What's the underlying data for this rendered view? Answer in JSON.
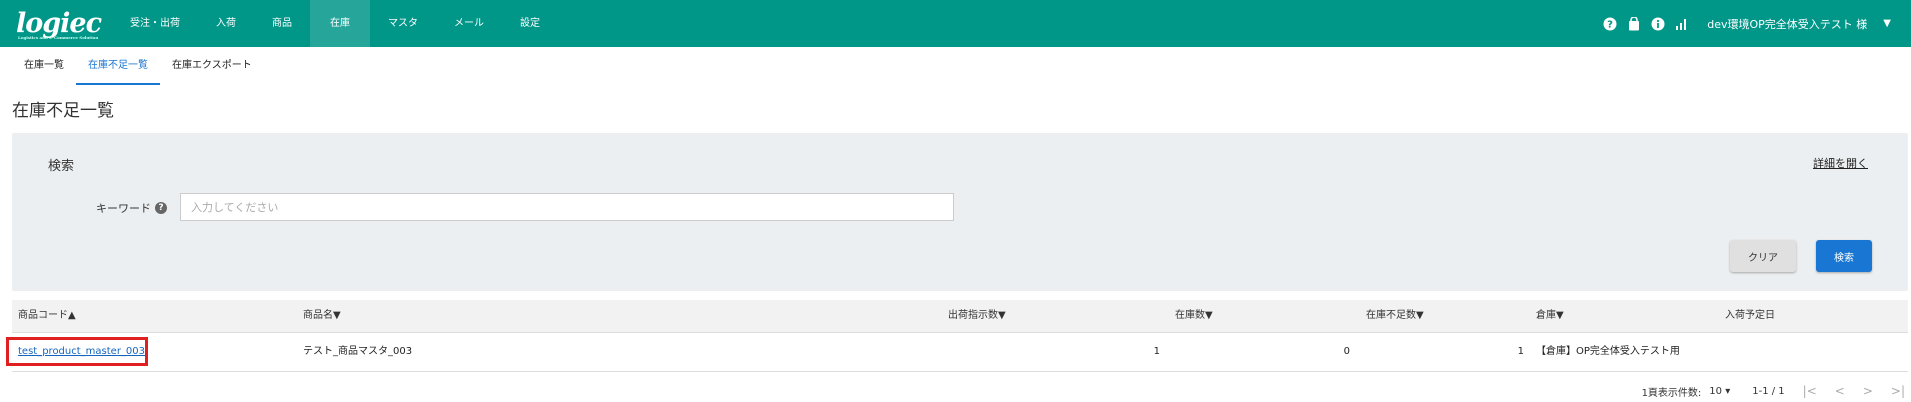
{
  "header": {
    "logo": "logiec",
    "logo_sub": "Logistics and E-Commerce Solution",
    "nav": [
      "受注・出荷",
      "入荷",
      "商品",
      "在庫",
      "マスタ",
      "メール",
      "設定"
    ],
    "active_nav": "在庫",
    "user": "dev環境OP完全体受入テスト 様",
    "icons": [
      "help-icon",
      "bag-icon",
      "info-icon",
      "signal-icon"
    ]
  },
  "subnav": {
    "tabs": [
      "在庫一覧",
      "在庫不足一覧",
      "在庫エクスポート"
    ],
    "active": "在庫不足一覧"
  },
  "page": {
    "title": "在庫不足一覧"
  },
  "search": {
    "title": "検索",
    "detail_link": "詳細を開く",
    "keyword_label": "キーワード",
    "keyword_help": "?",
    "keyword_placeholder": "入力してください",
    "keyword_value": "",
    "clear_label": "クリア",
    "search_label": "検索"
  },
  "table": {
    "columns": [
      "商品コード▲",
      "商品名▼",
      "出荷指示数▼",
      "在庫数▼",
      "在庫不足数▼",
      "倉庫▼",
      "入荷予定日"
    ],
    "rows": [
      {
        "code": "test_product_master_003",
        "name": "テスト_商品マスタ_003",
        "ship_qty": "1",
        "stock": "0",
        "shortage": "1",
        "warehouse": "【倉庫】OP完全体受入テスト用",
        "arrival": ""
      }
    ]
  },
  "footer": {
    "per_page_label": "1頁表示件数:",
    "per_page_value": "10",
    "range": "1-1 / 1",
    "pager": [
      "|<",
      "<",
      ">",
      ">|"
    ]
  },
  "colors": {
    "header": "#009688",
    "active_nav": "#26a69a",
    "primary": "#1976d2",
    "highlight": "#e02020"
  }
}
